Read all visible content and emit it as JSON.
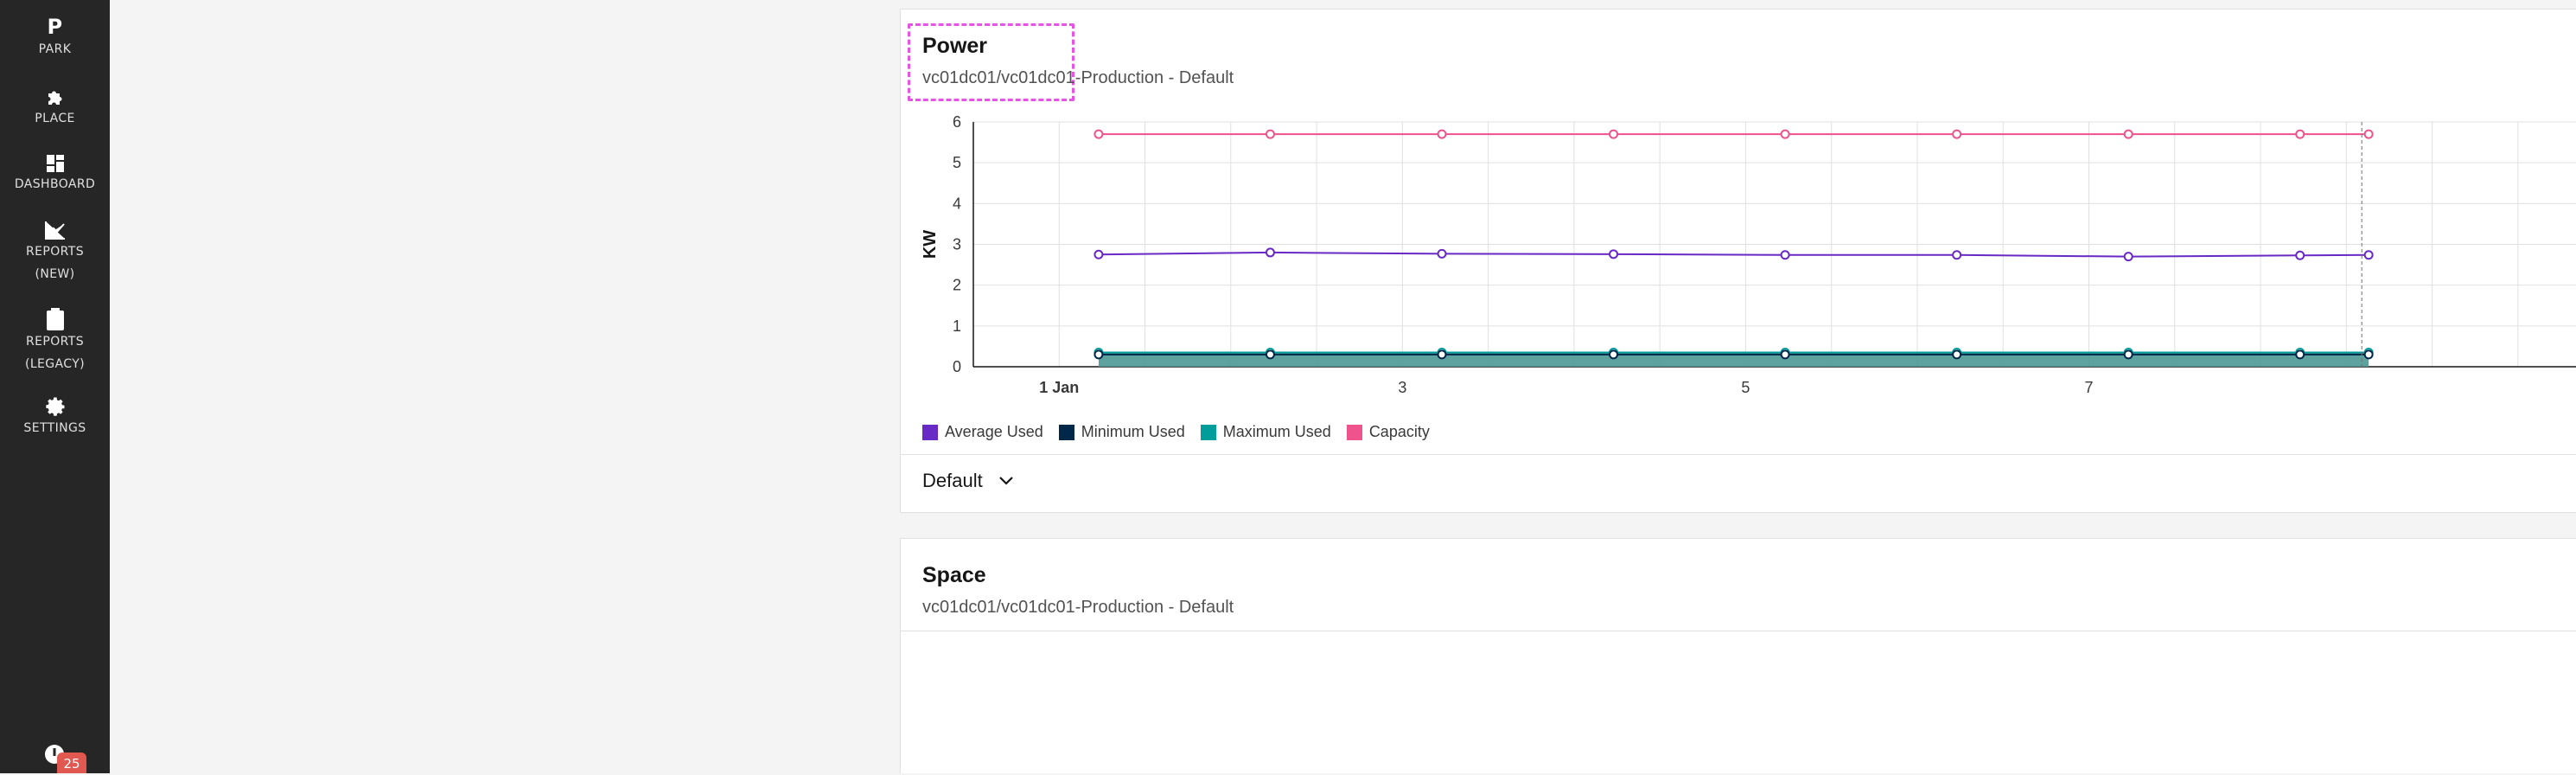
{
  "nav": {
    "logo": {
      "letter": "P",
      "label": "PARK"
    },
    "items": [
      {
        "label": "PLACE",
        "icon": "puzzle-icon"
      },
      {
        "label": "DASHBOARD",
        "icon": "dashboard-icon"
      },
      {
        "label": "REPORTS",
        "label2": "(NEW)",
        "icon": "chart-line-icon"
      },
      {
        "label": "REPORTS",
        "label2": "(LEGACY)",
        "icon": "clipboard-icon"
      },
      {
        "label": "SETTINGS",
        "icon": "gear-icon"
      }
    ],
    "notifications": {
      "count": "25",
      "icon": "alert-icon"
    }
  },
  "power_card": {
    "title": "Power",
    "subtitle": "vc01dc01/vc01dc01-Production - Default",
    "menu_icon": "overflow-menu-icon",
    "legend": [
      {
        "name": "Average Used",
        "color": "#6929c4"
      },
      {
        "name": "Minimum Used",
        "color": "#012749"
      },
      {
        "name": "Maximum Used",
        "color": "#009d9a"
      },
      {
        "name": "Capacity",
        "color": "#ee538b"
      }
    ],
    "dropdown": {
      "value": "Default",
      "icon": "chevron-down-icon"
    }
  },
  "space_card": {
    "title": "Space",
    "subtitle": "vc01dc01/vc01dc01-Production - Default",
    "menu_icon": "overflow-menu-icon"
  },
  "chart_data": {
    "type": "line",
    "ylabel": "KW",
    "xlabel": "",
    "ylim": [
      0,
      6
    ],
    "yticks": [
      "0",
      "1",
      "2",
      "3",
      "4",
      "5",
      "6"
    ],
    "xticks": [
      {
        "label": "1 Jan",
        "x": 1.0,
        "bold": true
      },
      {
        "label": "3",
        "x": 3.0,
        "bold": false
      },
      {
        "label": "5",
        "x": 5.0,
        "bold": false
      },
      {
        "label": "7",
        "x": 7.0,
        "bold": false
      }
    ],
    "xlim": [
      0.5,
      10.1
    ],
    "grid": true,
    "x": [
      1.23,
      2.23,
      3.23,
      4.23,
      5.23,
      6.23,
      7.23,
      8.23,
      8.63
    ],
    "series": [
      {
        "name": "Capacity",
        "color": "#ee538b",
        "values": [
          5.7,
          5.7,
          5.7,
          5.7,
          5.7,
          5.7,
          5.7,
          5.7,
          5.7
        ]
      },
      {
        "name": "Average Used",
        "color": "#6929c4",
        "values": [
          2.75,
          2.8,
          2.77,
          2.76,
          2.74,
          2.74,
          2.7,
          2.73,
          2.74
        ]
      },
      {
        "name": "Maximum Used",
        "color": "#009d9a",
        "values": [
          0.35,
          0.35,
          0.35,
          0.35,
          0.35,
          0.35,
          0.35,
          0.35,
          0.35
        ]
      },
      {
        "name": "Minimum Used",
        "color": "#012749",
        "values": [
          0.3,
          0.3,
          0.3,
          0.3,
          0.3,
          0.3,
          0.3,
          0.3,
          0.3
        ]
      }
    ],
    "hover_x": 8.59
  }
}
